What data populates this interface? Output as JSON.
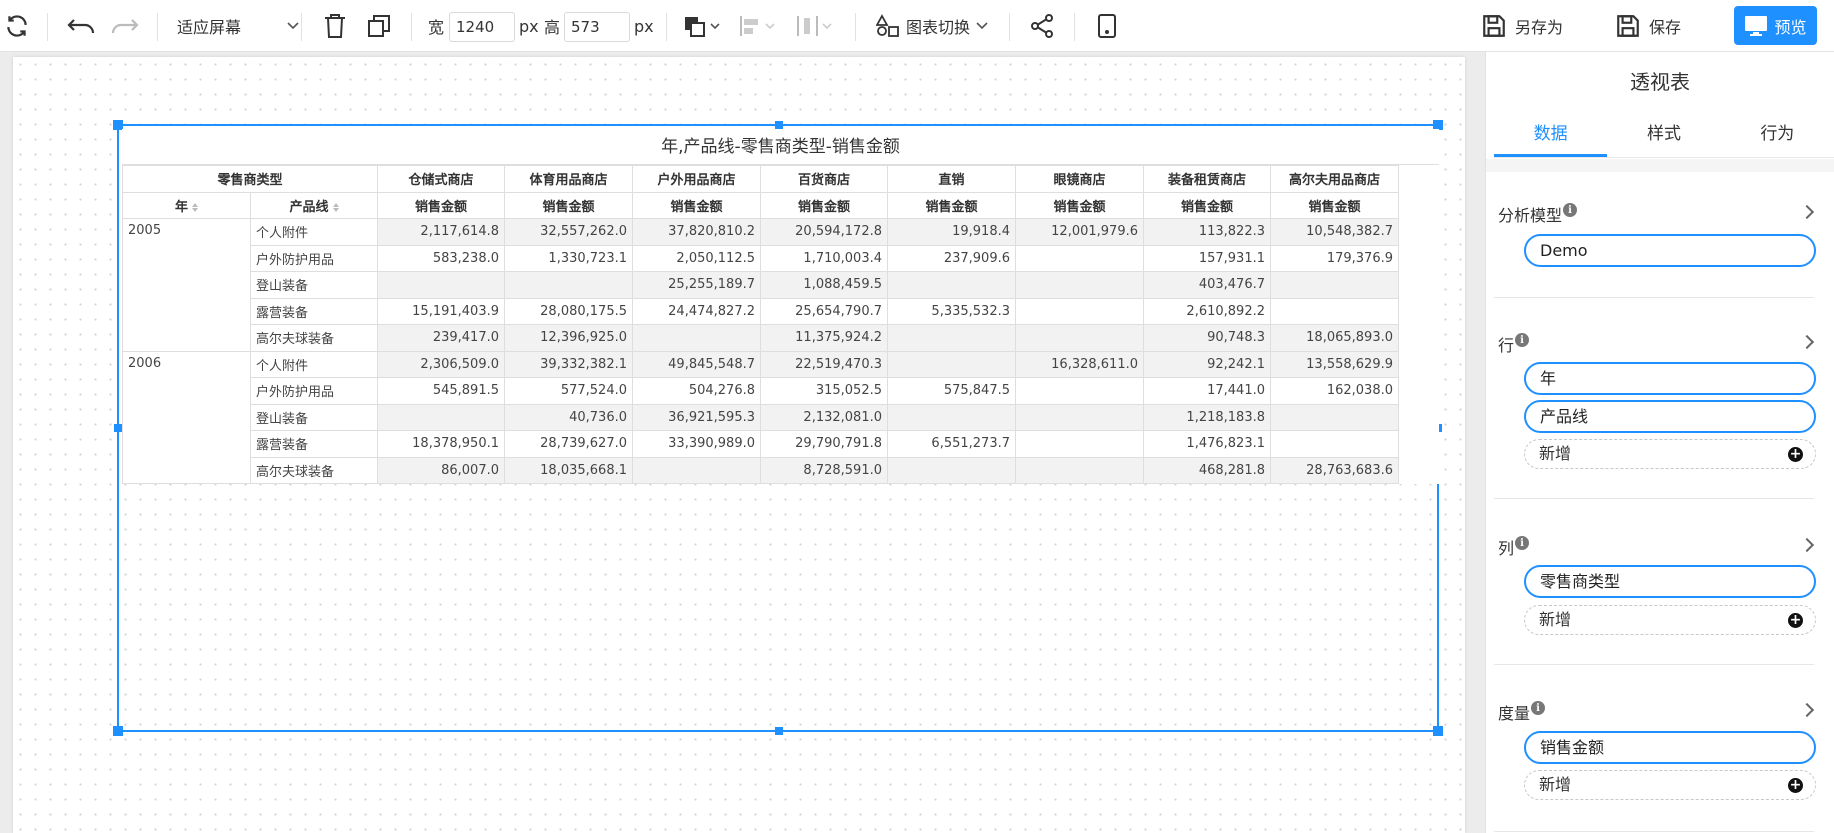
{
  "toolbar": {
    "fit_label": "适应屏幕",
    "width_label": "宽",
    "width_value": "1240",
    "height_label": "高",
    "height_value": "573",
    "px": "px",
    "chart_switch_label": "图表切换",
    "save_as_label": "另存为",
    "save_label": "保存",
    "preview_label": "预览"
  },
  "pivot": {
    "title": "年,产品线-零售商类型-销售金额",
    "corner_label": "零售商类型",
    "row_headers": [
      "年",
      "产品线"
    ],
    "measure_label": "销售金额",
    "columns": [
      "仓储式商店",
      "体育用品商店",
      "户外用品商店",
      "百货商店",
      "直销",
      "眼镜商店",
      "装备租赁商店",
      "高尔夫用品商店"
    ],
    "groups": [
      {
        "year": "2005",
        "rows": [
          {
            "product": "个人附件",
            "values": [
              "2,117,614.8",
              "32,557,262.0",
              "37,820,810.2",
              "20,594,172.8",
              "19,918.4",
              "12,001,979.6",
              "113,822.3",
              "10,548,382.7"
            ]
          },
          {
            "product": "户外防护用品",
            "values": [
              "583,238.0",
              "1,330,723.1",
              "2,050,112.5",
              "1,710,003.4",
              "237,909.6",
              "",
              "157,931.1",
              "179,376.9"
            ]
          },
          {
            "product": "登山装备",
            "values": [
              "",
              "",
              "25,255,189.7",
              "1,088,459.5",
              "",
              "",
              "403,476.7",
              ""
            ]
          },
          {
            "product": "露营装备",
            "values": [
              "15,191,403.9",
              "28,080,175.5",
              "24,474,827.2",
              "25,654,790.7",
              "5,335,532.3",
              "",
              "2,610,892.2",
              ""
            ]
          },
          {
            "product": "高尔夫球装备",
            "values": [
              "239,417.0",
              "12,396,925.0",
              "",
              "11,375,924.2",
              "",
              "",
              "90,748.3",
              "18,065,893.0"
            ]
          }
        ]
      },
      {
        "year": "2006",
        "rows": [
          {
            "product": "个人附件",
            "values": [
              "2,306,509.0",
              "39,332,382.1",
              "49,845,548.7",
              "22,519,470.3",
              "",
              "16,328,611.0",
              "92,242.1",
              "13,558,629.9"
            ]
          },
          {
            "product": "户外防护用品",
            "values": [
              "545,891.5",
              "577,524.0",
              "504,276.8",
              "315,052.5",
              "575,847.5",
              "",
              "17,441.0",
              "162,038.0"
            ]
          },
          {
            "product": "登山装备",
            "values": [
              "",
              "40,736.0",
              "36,921,595.3",
              "2,132,081.0",
              "",
              "",
              "1,218,183.8",
              ""
            ]
          },
          {
            "product": "露营装备",
            "values": [
              "18,378,950.1",
              "28,739,627.0",
              "33,390,989.0",
              "29,790,791.8",
              "6,551,273.7",
              "",
              "1,476,823.1",
              ""
            ]
          },
          {
            "product": "高尔夫球装备",
            "values": [
              "86,007.0",
              "18,035,668.1",
              "",
              "8,728,591.0",
              "",
              "",
              "468,281.8",
              "28,763,683.6"
            ]
          }
        ]
      }
    ]
  },
  "panel": {
    "title": "透视表",
    "tabs": [
      "数据",
      "样式",
      "行为"
    ],
    "model_label": "分析模型",
    "model_value": "Demo",
    "rows_label": "行",
    "rows_items": [
      "年",
      "产品线"
    ],
    "cols_label": "列",
    "cols_items": [
      "零售商类型"
    ],
    "measures_label": "度量",
    "measures_items": [
      "销售金额"
    ],
    "add_label": "新增"
  }
}
